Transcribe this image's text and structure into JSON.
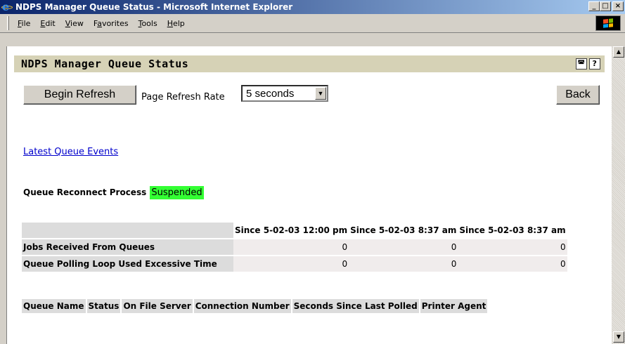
{
  "window": {
    "title": "NDPS Manager Queue Status - Microsoft Internet Explorer",
    "controls": [
      "_",
      "□",
      "×"
    ]
  },
  "menu": [
    {
      "label": "File",
      "accel": "F",
      "rest": "ile"
    },
    {
      "label": "Edit",
      "accel": "E",
      "rest": "dit"
    },
    {
      "label": "View",
      "accel": "V",
      "rest": "iew"
    },
    {
      "label": "Favorites",
      "prefix": "F",
      "accel": "a",
      "rest": "vorites"
    },
    {
      "label": "Tools",
      "accel": "T",
      "rest": "ools"
    },
    {
      "label": "Help",
      "accel": "H",
      "rest": "elp"
    }
  ],
  "header": {
    "title": "NDPS Manager Queue Status",
    "icons": [
      "window-icon",
      "help-icon"
    ],
    "help_glyph": "?"
  },
  "toolbar": {
    "refresh_button": "Begin Refresh",
    "refresh_rate_label": "Page Refresh Rate",
    "refresh_rate_value": "5 seconds",
    "back_button": "Back"
  },
  "links": {
    "latest_events": "Latest Queue Events"
  },
  "reconnect": {
    "label": "Queue Reconnect Process",
    "status": "Suspended",
    "status_color": "#33ff33"
  },
  "stats": {
    "columns": [
      "Since 5-02-03 12:00 pm",
      "Since 5-02-03 8:37 am",
      "Since 5-02-03 8:37 am"
    ],
    "rows": [
      {
        "label": "Jobs Received From Queues",
        "values": [
          "0",
          "0",
          "0"
        ]
      },
      {
        "label": "Queue Polling Loop Used Excessive Time",
        "values": [
          "0",
          "0",
          "0"
        ]
      }
    ]
  },
  "queue_table": {
    "columns": [
      "Queue Name",
      "Status",
      "On File Server",
      "Connection Number",
      "Seconds Since Last Polled",
      "Printer Agent"
    ]
  },
  "colors": {
    "titlebar_start": "#0a246a",
    "header_bg": "#d6d2b6",
    "link": "#0000cc"
  }
}
